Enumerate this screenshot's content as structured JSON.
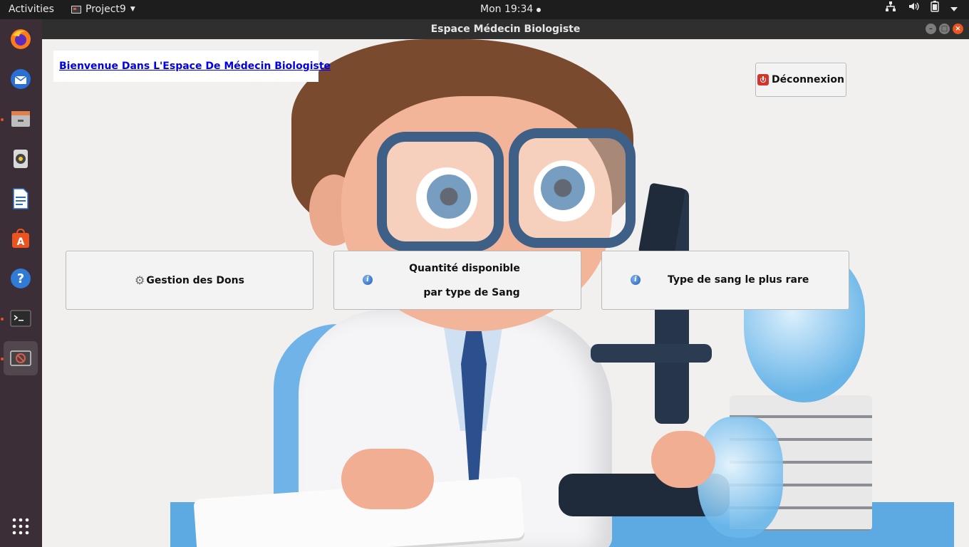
{
  "topbar": {
    "activities": "Activities",
    "app_name": "Project9",
    "clock": "Mon 19:34",
    "tray_icons": [
      "network-icon",
      "volume-icon",
      "battery-icon",
      "system-menu-icon"
    ]
  },
  "dock": {
    "items": [
      {
        "name": "firefox-icon",
        "running": false
      },
      {
        "name": "thunderbird-icon",
        "running": false
      },
      {
        "name": "files-icon",
        "running": true
      },
      {
        "name": "rhythmbox-icon",
        "running": false
      },
      {
        "name": "writer-icon",
        "running": false
      },
      {
        "name": "software-icon",
        "running": false
      },
      {
        "name": "help-icon",
        "running": false
      },
      {
        "name": "terminal-icon",
        "running": true
      },
      {
        "name": "java-app-icon",
        "running": true,
        "active": true
      },
      {
        "name": "show-apps-icon",
        "running": false
      }
    ]
  },
  "window": {
    "title": "Espace Médecin Biologiste",
    "welcome": "Bienvenue Dans L'Espace De Médecin Biologiste",
    "logout_label": "Déconnexion",
    "buttons": {
      "gestion": "Gestion des Dons",
      "quantite_line1": "Quantité disponible",
      "quantite_line2": "par type de Sang",
      "type_rare": "Type de sang le plus rare"
    }
  },
  "colors": {
    "link": "#0000ee",
    "accent": "#e95420",
    "content_bg": "#f1f0ef"
  }
}
